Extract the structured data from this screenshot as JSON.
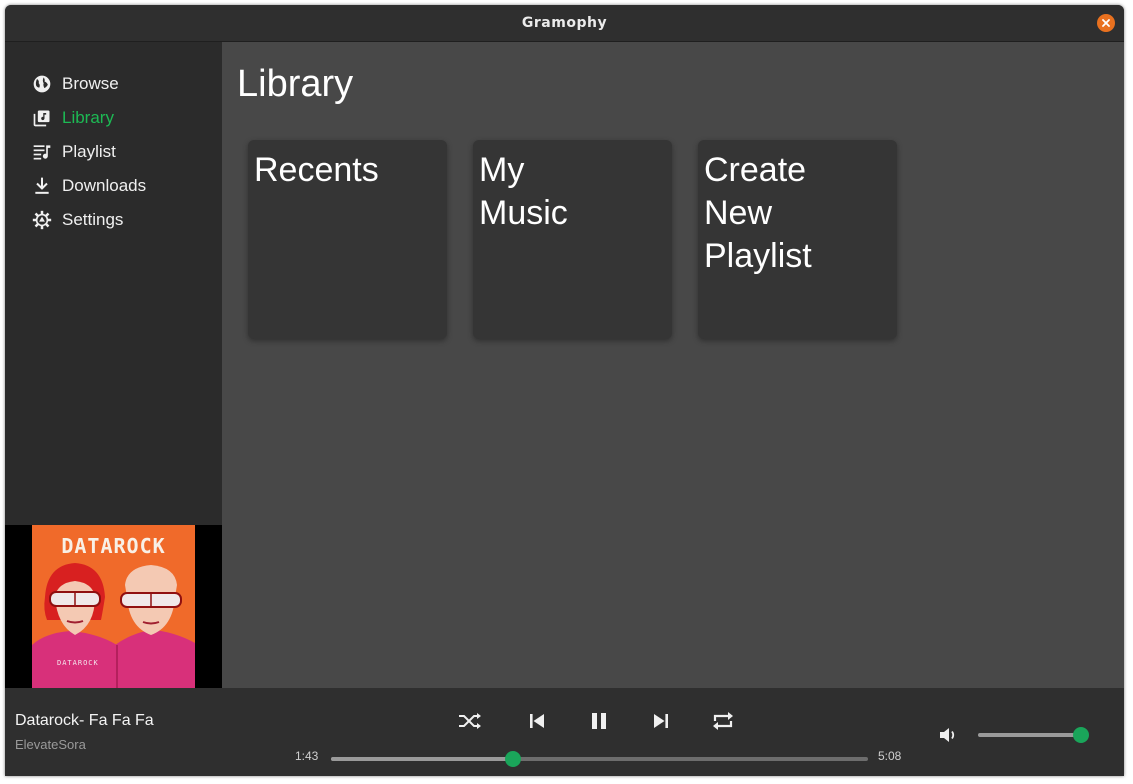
{
  "window": {
    "title": "Gramophy"
  },
  "sidebar": {
    "items": [
      {
        "label": "Browse",
        "icon": "globe-icon"
      },
      {
        "label": "Library",
        "icon": "library-icon",
        "active": true
      },
      {
        "label": "Playlist",
        "icon": "playlist-icon"
      },
      {
        "label": "Downloads",
        "icon": "download-icon"
      },
      {
        "label": "Settings",
        "icon": "gear-icon"
      }
    ],
    "album_art": {
      "text": "DATAROCK",
      "shirt_text": "DATAROCK",
      "icon": "album-art-image"
    }
  },
  "main": {
    "title": "Library",
    "cards": [
      {
        "label": "Recents"
      },
      {
        "label": "My\nMusic"
      },
      {
        "label": "Create\nNew\nPlaylist"
      }
    ]
  },
  "player": {
    "track_title": "Datarock- Fa Fa Fa",
    "artist": "ElevateSora",
    "elapsed": "1:43",
    "duration": "5:08",
    "progress_fraction": 0.338,
    "volume_fraction": 1.0,
    "controls": [
      "shuffle-icon",
      "previous-icon",
      "pause-icon",
      "next-icon",
      "repeat-icon"
    ]
  },
  "colors": {
    "accent": "#1db954",
    "knob": "#1aa55a",
    "close": "#e9711f"
  }
}
